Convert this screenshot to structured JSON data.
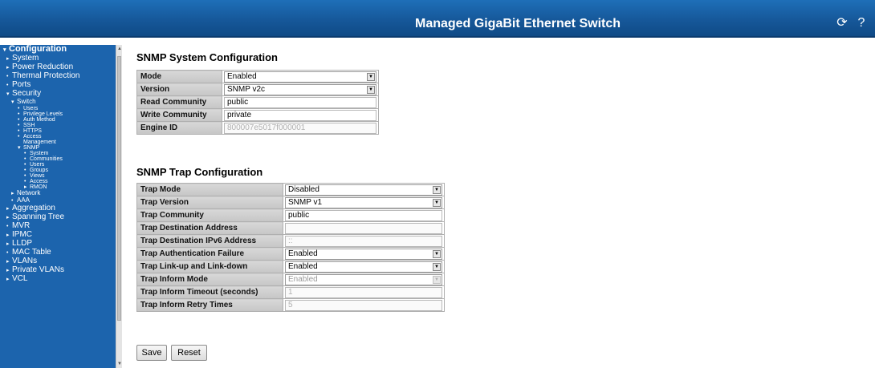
{
  "header": {
    "title": "Managed GigaBit Ethernet Switch",
    "icon_refresh": "refresh-icon",
    "icon_help": "help-icon"
  },
  "sidebar": {
    "items": [
      {
        "label": "Configuration",
        "level": 0,
        "mark": "▾"
      },
      {
        "label": "System",
        "level": 1,
        "mark": "▸"
      },
      {
        "label": "Power Reduction",
        "level": 1,
        "mark": "▸"
      },
      {
        "label": "Thermal Protection",
        "level": 1,
        "mark": "•"
      },
      {
        "label": "Ports",
        "level": 1,
        "mark": "•"
      },
      {
        "label": "Security",
        "level": 1,
        "mark": "▾"
      },
      {
        "label": "Switch",
        "level": 2,
        "mark": "▾"
      },
      {
        "label": "Users",
        "level": 3,
        "mark": "•"
      },
      {
        "label": "Privilege Levels",
        "level": 3,
        "mark": "•"
      },
      {
        "label": "Auth Method",
        "level": 3,
        "mark": "•"
      },
      {
        "label": "SSH",
        "level": 3,
        "mark": "•"
      },
      {
        "label": "HTTPS",
        "level": 3,
        "mark": "•"
      },
      {
        "label": "Access",
        "level": 3,
        "mark": "•"
      },
      {
        "label": "Management",
        "level": 3,
        "mark": " "
      },
      {
        "label": "SNMP",
        "level": 3,
        "mark": "▾"
      },
      {
        "label": "System",
        "level": 4,
        "mark": "•"
      },
      {
        "label": "Communities",
        "level": 4,
        "mark": "•"
      },
      {
        "label": "Users",
        "level": 4,
        "mark": "•"
      },
      {
        "label": "Groups",
        "level": 4,
        "mark": "•"
      },
      {
        "label": "Views",
        "level": 4,
        "mark": "•"
      },
      {
        "label": "Access",
        "level": 4,
        "mark": "•"
      },
      {
        "label": "RMON",
        "level": 4,
        "mark": "▸"
      },
      {
        "label": "Network",
        "level": 2,
        "mark": "▸"
      },
      {
        "label": "AAA",
        "level": 2,
        "mark": "•"
      },
      {
        "label": "Aggregation",
        "level": 1,
        "mark": "▸"
      },
      {
        "label": "Spanning Tree",
        "level": 1,
        "mark": "▸"
      },
      {
        "label": "MVR",
        "level": 1,
        "mark": "•"
      },
      {
        "label": "IPMC",
        "level": 1,
        "mark": "▸"
      },
      {
        "label": "LLDP",
        "level": 1,
        "mark": "▸"
      },
      {
        "label": "MAC Table",
        "level": 1,
        "mark": "•"
      },
      {
        "label": "VLANs",
        "level": 1,
        "mark": "▸"
      },
      {
        "label": "Private VLANs",
        "level": 1,
        "mark": "▸"
      },
      {
        "label": "VCL",
        "level": 1,
        "mark": "▸"
      }
    ]
  },
  "system_config": {
    "heading": "SNMP System Configuration",
    "mode_label": "Mode",
    "mode_value": "Enabled",
    "version_label": "Version",
    "version_value": "SNMP v2c",
    "read_community_label": "Read Community",
    "read_community_value": "public",
    "write_community_label": "Write Community",
    "write_community_value": "private",
    "engine_id_label": "Engine ID",
    "engine_id_value": "800007e5017f000001"
  },
  "trap_config": {
    "heading": "SNMP Trap Configuration",
    "trap_mode_label": "Trap Mode",
    "trap_mode_value": "Disabled",
    "trap_version_label": "Trap Version",
    "trap_version_value": "SNMP v1",
    "trap_community_label": "Trap Community",
    "trap_community_value": "public",
    "dest_addr_label": "Trap Destination Address",
    "dest_addr_value": "",
    "dest_ipv6_label": "Trap Destination IPv6 Address",
    "dest_ipv6_value": "::",
    "auth_failure_label": "Trap Authentication Failure",
    "auth_failure_value": "Enabled",
    "link_updown_label": "Trap Link-up and Link-down",
    "link_updown_value": "Enabled",
    "inform_mode_label": "Trap Inform Mode",
    "inform_mode_value": "Enabled",
    "inform_timeout_label": "Trap Inform Timeout (seconds)",
    "inform_timeout_value": "1",
    "inform_retry_label": "Trap Inform Retry Times",
    "inform_retry_value": "5"
  },
  "buttons": {
    "save": "Save",
    "reset": "Reset"
  }
}
